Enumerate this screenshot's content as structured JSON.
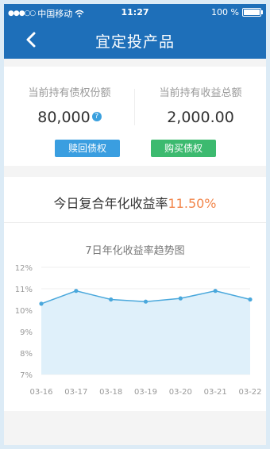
{
  "status": {
    "carrier": "中国移动",
    "time": "11:27",
    "battery": "100 %"
  },
  "nav": {
    "title": "宜定投产品"
  },
  "holdings": {
    "bond_share_label": "当前持有债权份额",
    "bond_share_value": "80,000",
    "earnings_label": "当前持有收益总额",
    "earnings_value": "2,000.00",
    "help_glyph": "?",
    "redeem_label": "赎回债权",
    "buy_label": "购买债权"
  },
  "rate": {
    "label": "今日复合年化收益率",
    "value": "11.50%"
  },
  "chart_data": {
    "type": "area",
    "title": "7日年化收益率趋势图",
    "x": [
      "03-16",
      "03-17",
      "03-18",
      "03-19",
      "03-20",
      "03-21",
      "03-22"
    ],
    "values": [
      10.3,
      10.9,
      10.5,
      10.4,
      10.55,
      10.9,
      10.5
    ],
    "y_ticks": [
      "12%",
      "11%",
      "10%",
      "9%",
      "8%",
      "7%"
    ],
    "ylim": [
      7,
      12
    ],
    "grid": true,
    "line_color": "#4aa8dc",
    "fill_color": "#dff0fa"
  }
}
